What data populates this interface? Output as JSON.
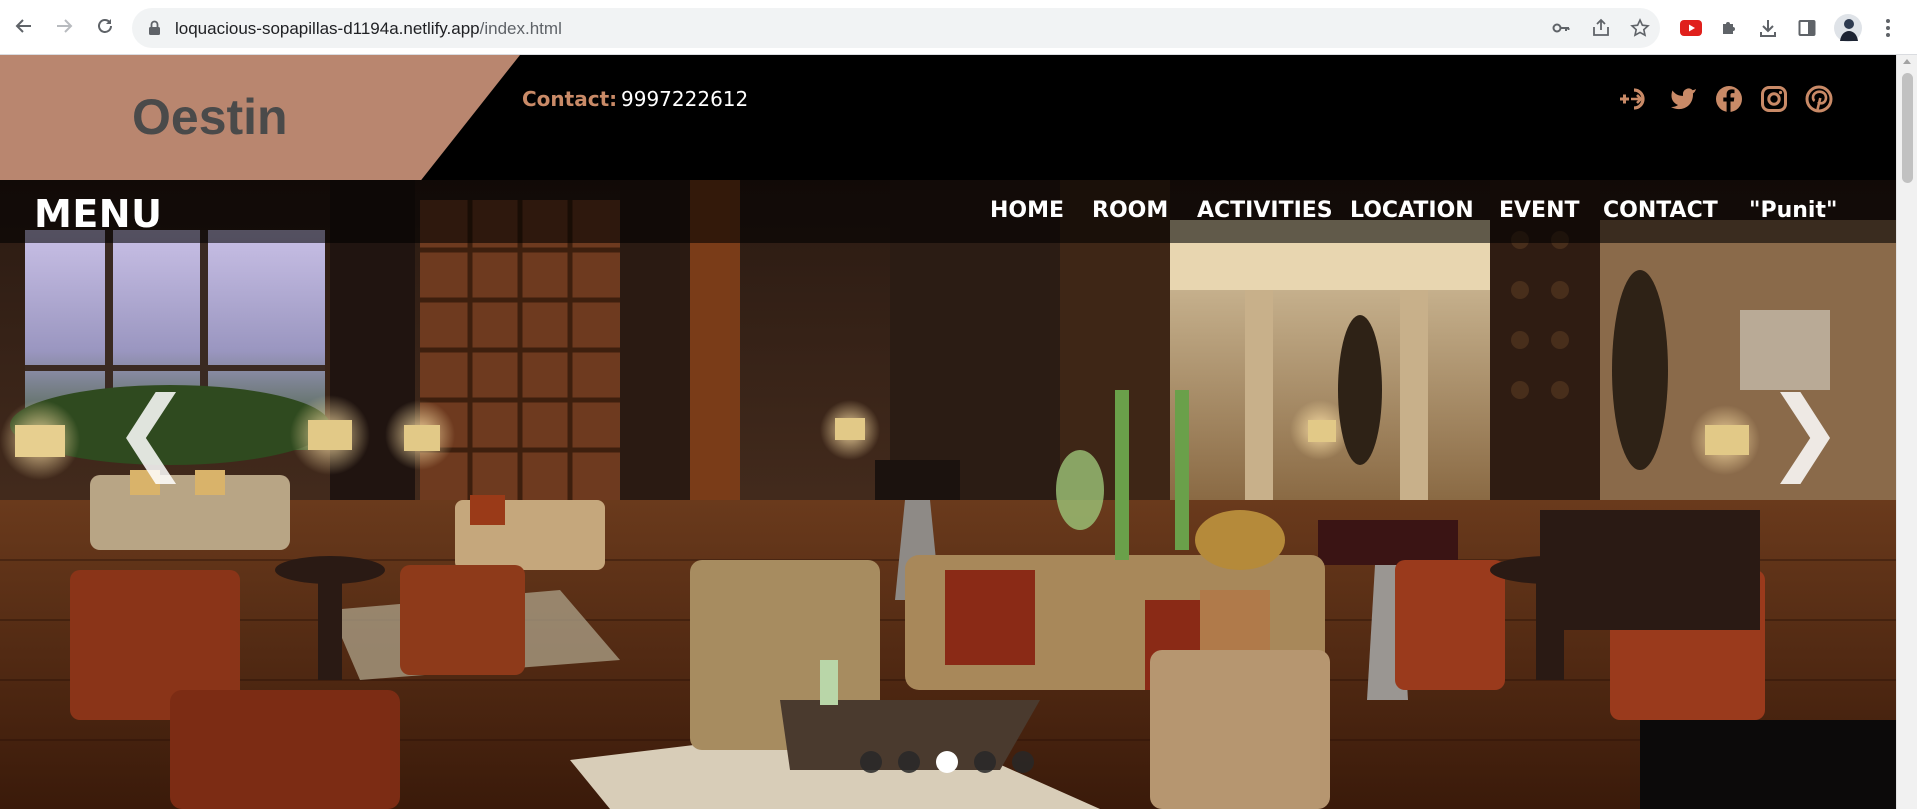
{
  "browser": {
    "url_host": "loquacious-sopapillas-d1194a.netlify.app",
    "url_path": "/index.html",
    "icons": {
      "back": "back-arrow-icon",
      "forward": "forward-arrow-icon",
      "reload": "reload-icon",
      "lock": "lock-icon",
      "key": "key-icon",
      "share": "share-icon",
      "bookmark": "star-icon",
      "youtube": "youtube-extension-icon",
      "extensions": "puzzle-icon",
      "download": "download-icon",
      "sidepanel": "side-panel-icon",
      "profile": "avatar",
      "menu": "kebab-menu-icon"
    }
  },
  "header": {
    "brand": "Oestin",
    "contact_label": "Contact:",
    "contact_value": "9997222612",
    "social_icons": [
      "login-icon",
      "twitter-icon",
      "facebook-icon",
      "instagram-icon",
      "pinterest-icon"
    ]
  },
  "nav": {
    "menu_title": "MENU",
    "links": [
      "HOME",
      "ROOM",
      "ACTIVITIES",
      "LOCATION",
      "EVENT",
      "CONTACT",
      "\"Punit\""
    ]
  },
  "hero": {
    "prev": "❮",
    "next": "❯",
    "slide_count": 5,
    "active_slide": 3
  },
  "colors": {
    "brand_block": "#b9866f",
    "contact_label": "#c98a67",
    "topbar": "#000000",
    "social_icon": "#c98a67"
  }
}
